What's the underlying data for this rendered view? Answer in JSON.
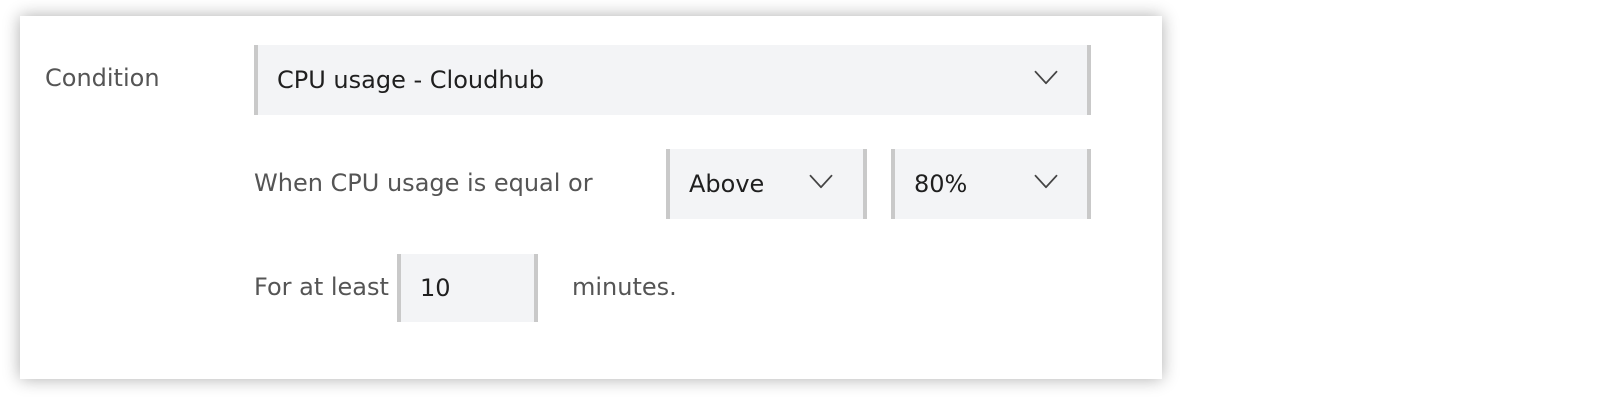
{
  "condition": {
    "label": "Condition",
    "metric_select": {
      "value": "CPU usage - Cloudhub"
    }
  },
  "threshold": {
    "prefix_text": "When CPU usage is equal or",
    "comparator_select": {
      "value": "Above"
    },
    "percent_select": {
      "value": "80%"
    }
  },
  "duration": {
    "prefix_text": "For at least",
    "minutes_input": {
      "value": "10"
    },
    "suffix_text": "minutes."
  },
  "icons": {
    "dropdown": "chevron-down-icon"
  },
  "colors": {
    "field_background": "#f3f4f6",
    "field_border": "#c9c9c9",
    "label_text": "#555555",
    "value_text": "#1f1f1f"
  }
}
